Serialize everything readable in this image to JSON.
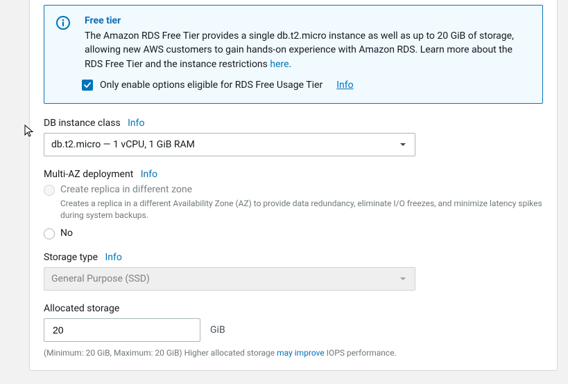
{
  "colors": {
    "link": "#0073bb"
  },
  "callout": {
    "title": "Free tier",
    "text_pre": "The Amazon RDS Free Tier provides a single db.t2.micro instance as well as up to 20 GiB of storage, allowing new AWS customers to gain hands-on experience with Amazon RDS. Learn more about the RDS Free Tier and the instance restrictions ",
    "link_label": "here",
    "text_post": ".",
    "checkbox_label": "Only enable options eligible for RDS Free Usage Tier",
    "checkbox_info": "Info"
  },
  "db_instance": {
    "label": "DB instance class",
    "info": "Info",
    "value": "db.t2.micro — 1 vCPU, 1 GiB RAM"
  },
  "multi_az": {
    "label": "Multi-AZ deployment",
    "info": "Info",
    "option_create_label": "Create replica in different zone",
    "option_create_desc": "Creates a replica in a different Availability Zone (AZ) to provide data redundancy, eliminate I/O freezes, and minimize latency spikes during system backups.",
    "option_no_label": "No"
  },
  "storage_type": {
    "label": "Storage type",
    "info": "Info",
    "value": "General Purpose (SSD)"
  },
  "allocated_storage": {
    "label": "Allocated storage",
    "value": "20",
    "unit": "GiB",
    "helper_pre": "(Minimum: 20 GiB, Maximum: 20 GiB) Higher allocated storage ",
    "helper_link": "may improve",
    "helper_post": " IOPS performance."
  }
}
